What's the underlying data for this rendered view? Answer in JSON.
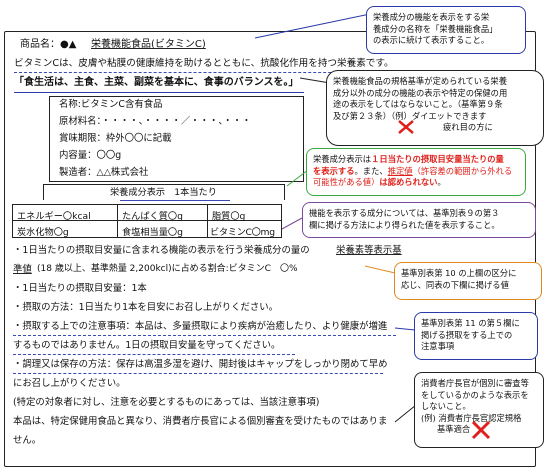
{
  "product_header": {
    "name_label": "商品名：●▲",
    "name_value": "栄養機能食品(ビタミンC)"
  },
  "vitamin_statement": "ビタミンCは、皮膚や粘膜の健康維持を助けるとともに、抗酸化作用を持つ栄養素です。",
  "diet_slogan": "「食生活は、主食、主菜、副菜を基本に、食事のバランスを。」",
  "label_box": {
    "name": "名称:ビタミンC含有食品",
    "ingredients": "原材料名：・・・・、・・・・／・・・、・・・",
    "best_before": "賞味期限：枠外〇〇に記載",
    "content": "内容量：〇〇g",
    "manufacturer": "製造者：△△株式会社"
  },
  "nutrition_table": {
    "title": "栄養成分表示　1本当たり",
    "cells": [
      [
        "エネルギー〇kcal",
        "たんぱく質〇g",
        "脂質〇g"
      ],
      [
        "炭水化物〇g",
        "食塩相当量〇g",
        "ビタミンC〇mg"
      ]
    ]
  },
  "intake_notes": {
    "line1_a": "・1日当たりの摂取目安量に含まれる機能の表示を行う栄養成分の量の",
    "line1_b": "栄養素等表示基",
    "line2_a": "準値",
    "line2_b": "(18 歳以上、基準熱量 2,200kcl)に占める割合:ビタミンC　〇%",
    "line3": "・1日当たりの摂取目安量：1本",
    "line4": "・摂取の方法：1日当たり1本を目安にお召し上がりください。",
    "line5": "・摂取する上での注意事項：本品は、多量摂取により疾病が治癒したり、より健康が増進",
    "line6": "するものではありません。1日の摂取目安量を守ってください。",
    "line7": "・調理又は保存の方法：保存は高温多湿を避け、開封後はキャップをしっかり閉めて早め",
    "line8": "にお召し上がりください。",
    "line9": "(特定の対象者に対し、注意を必要とするものにあっては、当該注意事項)",
    "line10": "本品は、特定保健用食品と異なり、消費者庁長官による個別審査を受けたものではありま",
    "line11": "せん。"
  },
  "callouts": {
    "c1": [
      "栄養成分の機能を表示をする栄",
      "養成分の名称を「栄養機能食品」",
      "の表示に続けて表示すること。"
    ],
    "c2": [
      "栄養機能食品の規格基準が定められている栄養",
      "成分以外の成分の機能の表示や特定の保健の用",
      "途の表示をしてはならないこと。（基準第９条",
      "及び第２３条）（例）ダイエットできます"
    ],
    "c2_strike": "疲れ目の方に",
    "c3": {
      "a": "栄養成分表示は",
      "red1": "１日当たりの摂取目安量当たりの量",
      "red2": "を表示する",
      "b": "。また、",
      "c": "推定値",
      "d": "（許容差の範囲から外れる",
      "e": "可能性がある値）",
      "red3": "は認められない",
      "f": "。"
    },
    "c4": [
      "機能を表示する成分については、基準別表９の第３",
      "欄に掲げる方法により得られた値を表示すること。"
    ],
    "c5": [
      "基準別表第 10 の上欄の区分に",
      "応じ、同表の下欄に掲げる値"
    ],
    "c6": [
      "基準別表第 11 の第５欄に",
      "掲げる摂取をする上での",
      "注意事項"
    ],
    "c7": [
      "消費者庁長官が個別に審査等",
      "をしているかのような表示を",
      "しないこと。"
    ],
    "c7_example_prefix": "(例)",
    "c7_strike": "消費者庁長官認定規格",
    "c7_strike2": "基準適合"
  },
  "colors": {
    "blue_border": "#2a3aa8",
    "green_border": "#3aa83a",
    "purple_border": "#7a4a9a",
    "orange_border": "#e08a1a",
    "red_text": "#e0201a"
  }
}
